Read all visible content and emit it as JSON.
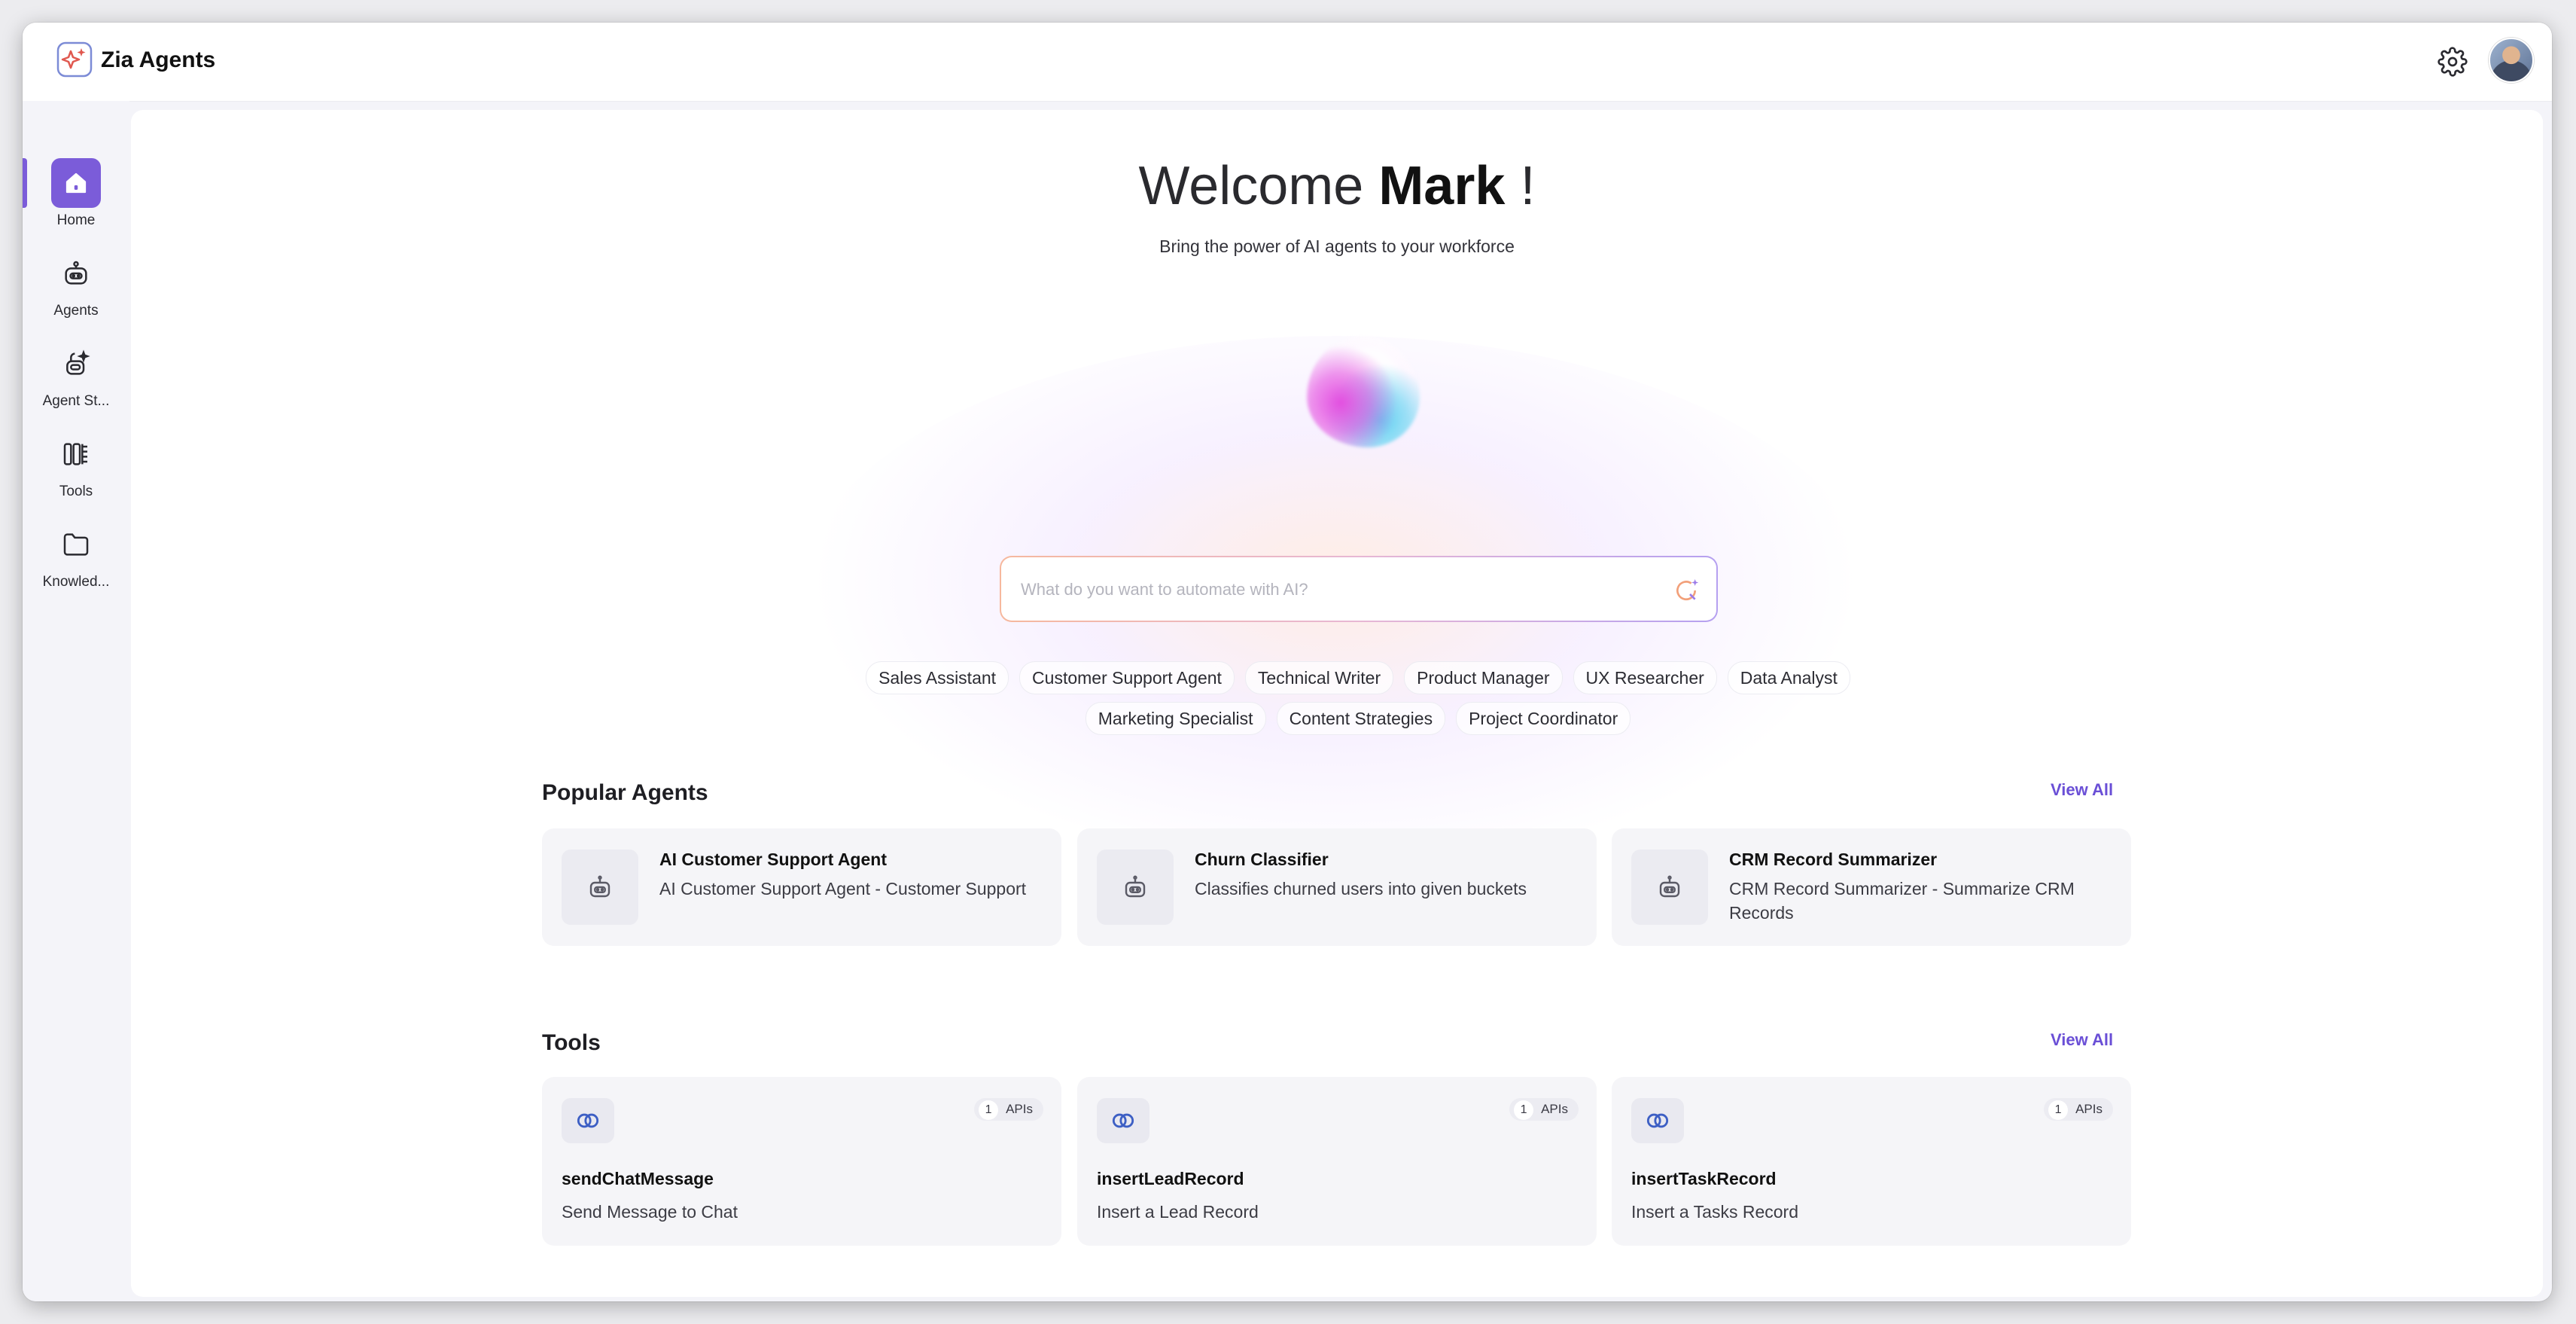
{
  "app": {
    "title": "Zia Agents"
  },
  "header": {
    "settings_icon": "gear-icon",
    "avatar": "user-avatar"
  },
  "sidebar": {
    "items": [
      {
        "label": "Home",
        "icon": "home-icon",
        "active": true
      },
      {
        "label": "Agents",
        "icon": "robot-icon"
      },
      {
        "label": "Agent St...",
        "icon": "agent-studio-icon"
      },
      {
        "label": "Tools",
        "icon": "tools-icon"
      },
      {
        "label": "Knowled...",
        "icon": "folder-icon"
      }
    ]
  },
  "hero": {
    "welcome_prefix": "Welcome",
    "user_name": "Mark",
    "welcome_suffix": "!",
    "subtitle": "Bring the power of AI agents to your workforce",
    "search_placeholder": "What do you want to automate with AI?"
  },
  "suggestions": {
    "row1": [
      "Sales Assistant",
      "Customer Support Agent",
      "Technical Writer",
      "Product Manager",
      "UX Researcher",
      "Data Analyst"
    ],
    "row2": [
      "Marketing Specialist",
      "Content Strategies",
      "Project Coordinator"
    ]
  },
  "popular_agents": {
    "title": "Popular Agents",
    "view_all": "View All",
    "items": [
      {
        "name": "AI Customer Support Agent",
        "description": "AI Customer Support Agent - Customer Support"
      },
      {
        "name": "Churn Classifier",
        "description": "Classifies churned users into given buckets"
      },
      {
        "name": "CRM Record Summarizer",
        "description": "CRM Record Summarizer - Summarize CRM Records"
      }
    ]
  },
  "tools": {
    "title": "Tools",
    "view_all": "View All",
    "items": [
      {
        "name": "sendChatMessage",
        "description": "Send Message to Chat",
        "api_count": "1",
        "api_label": "APIs"
      },
      {
        "name": "insertLeadRecord",
        "description": "Insert a Lead Record",
        "api_count": "1",
        "api_label": "APIs"
      },
      {
        "name": "insertTaskRecord",
        "description": "Insert a Tasks Record",
        "api_count": "1",
        "api_label": "APIs"
      }
    ]
  },
  "colors": {
    "accent": "#7b5cd9",
    "link": "#6a4fd6",
    "card_bg": "#f5f5f8"
  }
}
